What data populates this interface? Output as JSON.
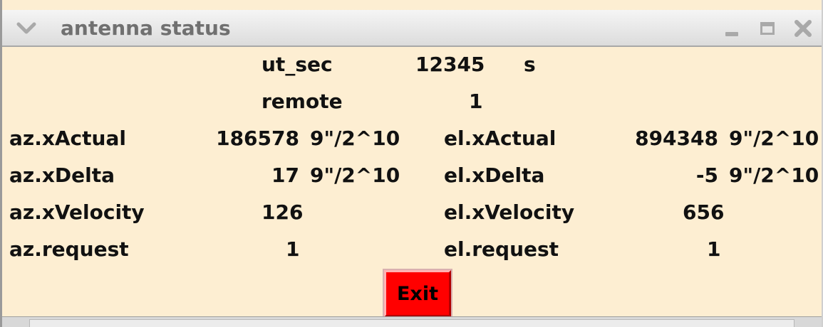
{
  "window": {
    "title": "antenna status"
  },
  "rows": {
    "ut_sec": {
      "label": "ut_sec",
      "value": "12345",
      "unit": "s"
    },
    "remote": {
      "label": "remote",
      "value": "1"
    },
    "az": {
      "xActual_label": "az.xActual",
      "xActual_value": "186578",
      "xActual_unit": "9\"/2^10",
      "xDelta_label": "az.xDelta",
      "xDelta_value": "17",
      "xDelta_unit": "9\"/2^10",
      "xVelocity_label": "az.xVelocity",
      "xVelocity_value": "126",
      "request_label": "az.request",
      "request_value": "1"
    },
    "el": {
      "xActual_label": "el.xActual",
      "xActual_value": "894348",
      "xActual_unit": "9\"/2^10",
      "xDelta_label": "el.xDelta",
      "xDelta_value": "-5",
      "xDelta_unit": "9\"/2^10",
      "xVelocity_label": "el.xVelocity",
      "xVelocity_value": "656",
      "request_label": "el.request",
      "request_value": "1"
    }
  },
  "buttons": {
    "exit_label": "Exit",
    "exit_color": "#ff0000"
  },
  "icons": {
    "window_menu": "chevron-down-icon",
    "minimize": "minimize-icon",
    "maximize": "maximize-icon",
    "close": "close-icon"
  }
}
